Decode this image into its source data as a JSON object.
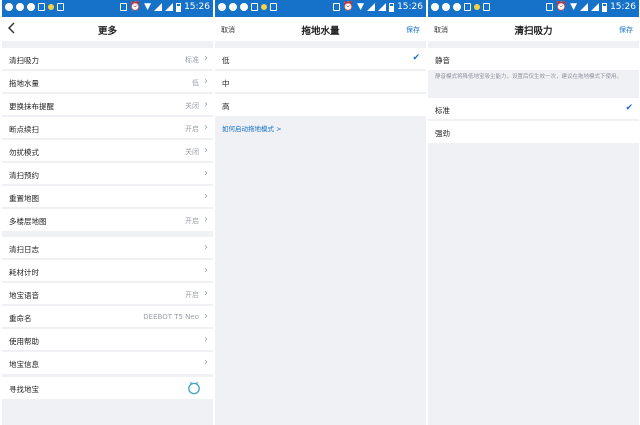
{
  "status": {
    "time": "15:26"
  },
  "colors": {
    "accent": "#1672c8",
    "status_bar": "#1672c8",
    "background": "#eff1f5"
  },
  "icons": {
    "back": "chevron-left-icon",
    "chevron": "chevron-right-icon",
    "check": "check-icon",
    "robot": "robot-icon"
  },
  "panel_more": {
    "title": "更多",
    "group1": [
      {
        "label": "清扫吸力",
        "value": "标准"
      },
      {
        "label": "拖地水量",
        "value": "低"
      },
      {
        "label": "更换抹布提醒",
        "value": "关闭"
      },
      {
        "label": "断点续扫",
        "value": "开启"
      },
      {
        "label": "勿扰模式",
        "value": "关闭"
      },
      {
        "label": "清扫预约",
        "value": ""
      },
      {
        "label": "重置地图",
        "value": ""
      },
      {
        "label": "多楼层地图",
        "value": "开启"
      }
    ],
    "group2": [
      {
        "label": "清扫日志",
        "value": ""
      },
      {
        "label": "耗材计时",
        "value": ""
      },
      {
        "label": "地宝语音",
        "value": "开启"
      },
      {
        "label": "重命名",
        "value": "DEEBOT T5 Neo"
      },
      {
        "label": "使用帮助",
        "value": ""
      },
      {
        "label": "地宝信息",
        "value": ""
      }
    ],
    "find_robot": {
      "label": "寻找地宝"
    }
  },
  "panel_water": {
    "cancel": "取消",
    "title": "拖地水量",
    "save": "保存",
    "options": [
      {
        "label": "低",
        "selected": true
      },
      {
        "label": "中",
        "selected": false
      },
      {
        "label": "高",
        "selected": false
      }
    ],
    "link": "如何启动拖地模式 >"
  },
  "panel_suction": {
    "cancel": "取消",
    "title": "清扫吸力",
    "save": "保存",
    "mute": {
      "label": "静音"
    },
    "note": "静音模式将降低地宝吸尘能力，设置后仅生效一次，建议在拖地模式下使用。",
    "options": [
      {
        "label": "标准",
        "selected": true
      },
      {
        "label": "强劲",
        "selected": false
      }
    ]
  }
}
